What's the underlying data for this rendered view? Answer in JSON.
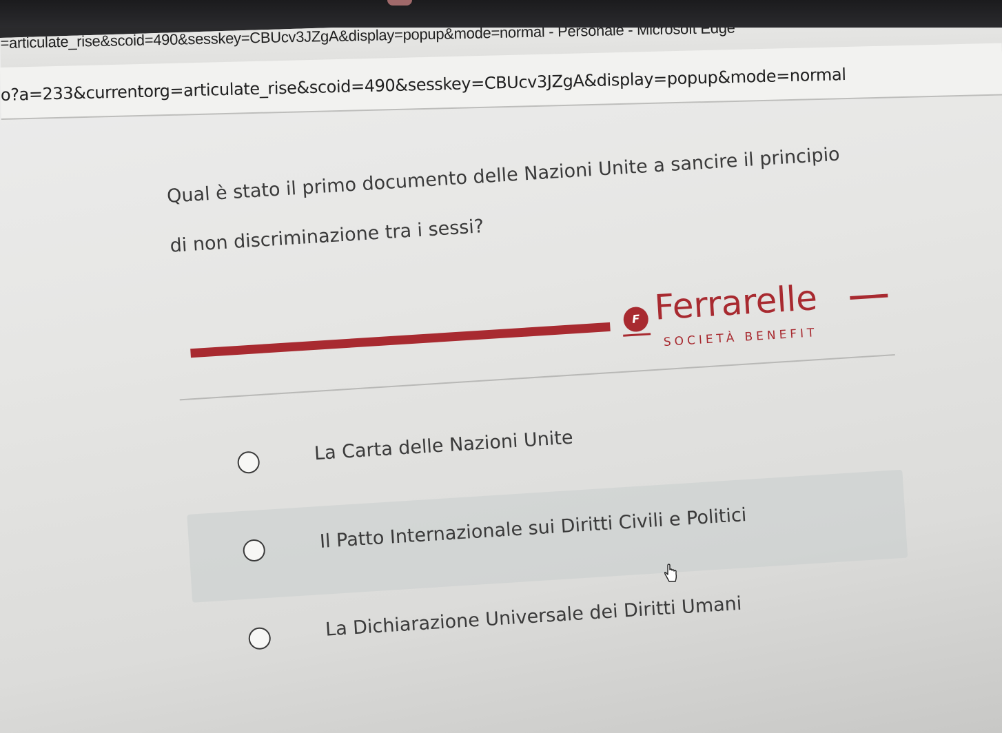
{
  "browser": {
    "window_title": "=articulate_rise&scoid=490&sesskey=CBUcv3JZgA&display=popup&mode=normal - Personale - Microsoft Edge",
    "address_url": "o?a=233&currentorg=articulate_rise&scoid=490&sesskey=CBUcv3JZgA&display=popup&mode=normal"
  },
  "quiz": {
    "question": "Qual è stato il primo documento delle Nazioni Unite a sancire il principio di non discriminazione tra i sessi?",
    "options": [
      {
        "label": "La Carta delle Nazioni Unite"
      },
      {
        "label": "Il Patto Internazionale sui Diritti Civili e Politici"
      },
      {
        "label": "La Dichiarazione Universale dei Diritti Umani"
      }
    ]
  },
  "brand": {
    "name": "Ferrarelle",
    "subtitle": "SOCIETÀ BENEFIT",
    "mark": "F",
    "color": "#a82a30"
  },
  "icons": {
    "radio": "radio-empty-icon",
    "cursor": "hand-pointer-icon"
  }
}
